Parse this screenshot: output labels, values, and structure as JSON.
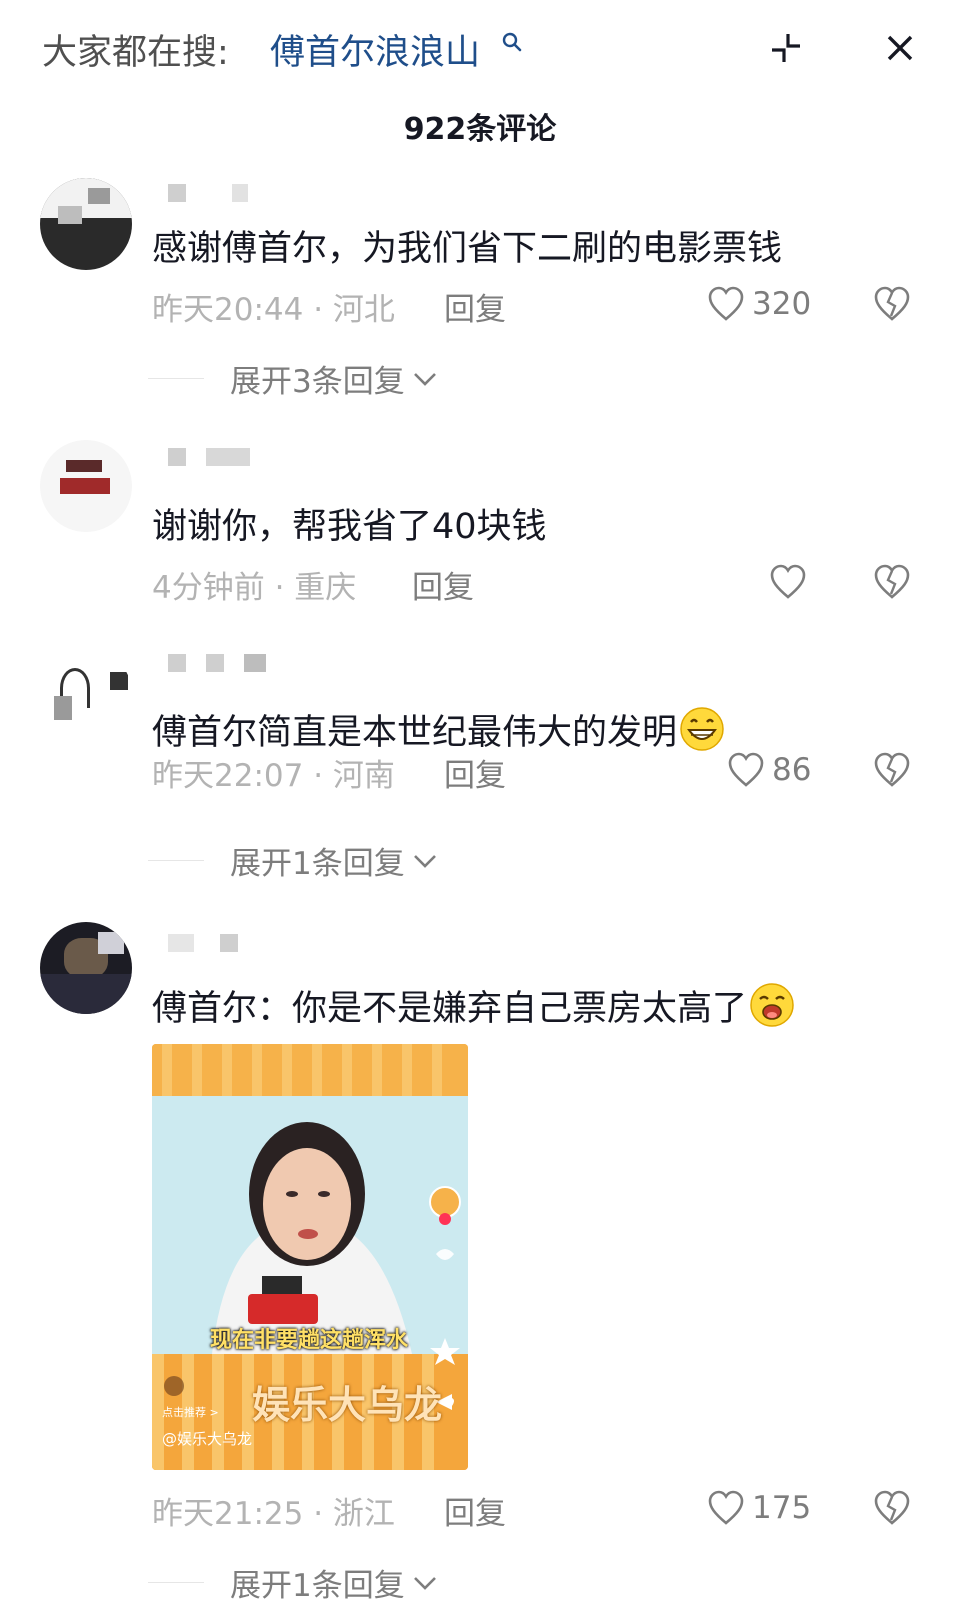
{
  "header": {
    "search_prefix": "大家都在搜:",
    "search_term": "傅首尔浪浪山",
    "icons": [
      "search-icon",
      "shrink-icon",
      "close-icon"
    ]
  },
  "comment_count": "922条评论",
  "comments": [
    {
      "text": "感谢傅首尔，为我们省下二刷的电影票钱",
      "meta": "昨天20:44 · 河北",
      "reply": "回复",
      "likes": "320",
      "expand": "展开3条回复"
    },
    {
      "text": "谢谢你，帮我省了40块钱",
      "meta": "4分钟前 · 重庆",
      "reply": "回复",
      "likes": "",
      "expand": ""
    },
    {
      "text": "傅首尔简直是本世纪最伟大的发明",
      "emoji": "grin-emoji",
      "meta": "昨天22:07 · 河南",
      "reply": "回复",
      "likes": "86",
      "expand": "展开1条回复"
    },
    {
      "text": "傅首尔：你是不是嫌弃自己票房太高了",
      "emoji": "laugh-emoji",
      "meta": "昨天21:25 · 浙江",
      "reply": "回复",
      "likes": "175",
      "expand": "展开1条回复",
      "thumbnail": {
        "caption": "现在非要趟这趟浑水",
        "brand": "娱乐大乌龙",
        "handle": "@娱乐大乌龙",
        "rec": "点击推荐 >"
      }
    }
  ],
  "colors": {
    "search_term": "#1f4e8a",
    "meta": "#b3b3b3",
    "secondary": "#7d7d7d"
  }
}
